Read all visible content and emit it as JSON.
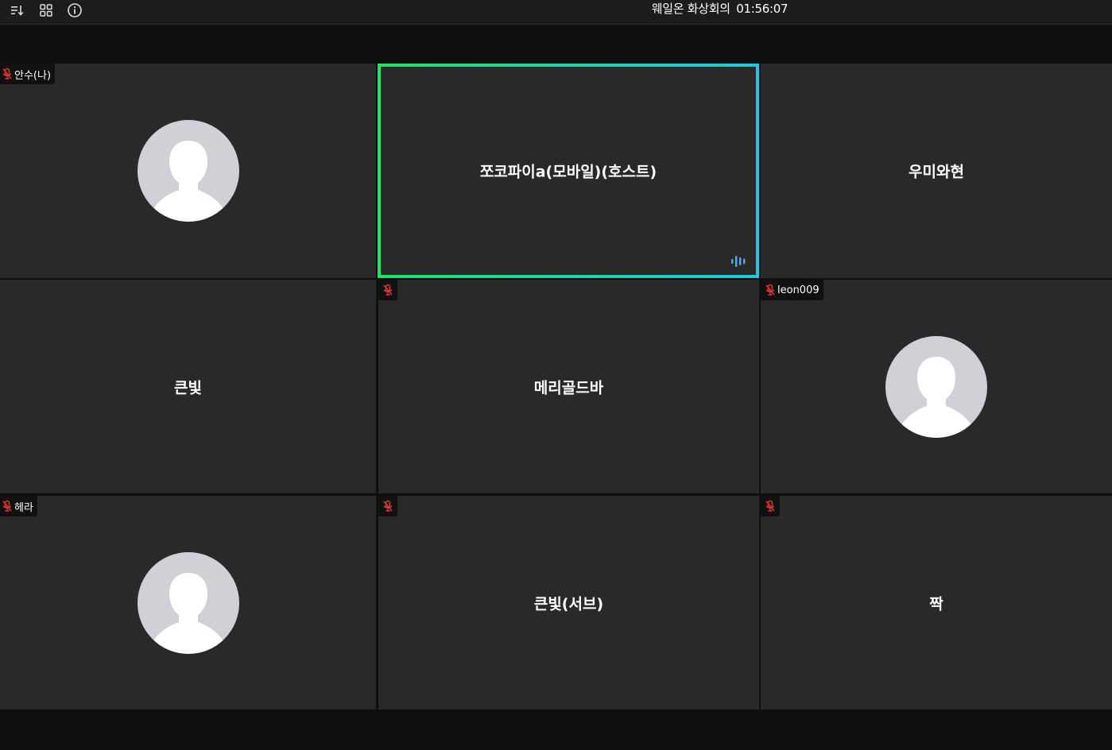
{
  "toolbar": {
    "icons": [
      "sort-list-icon",
      "grid-view-icon",
      "info-icon"
    ],
    "title": "웨일온 화상회의",
    "timer": "01:56:07"
  },
  "participants": [
    {
      "name": "안수(나)",
      "display": "avatar",
      "muted": true,
      "badge_label": "안수(나)"
    },
    {
      "name": "쪼코파이a(모바일)(호스트)",
      "display": "name",
      "muted": false,
      "speaking": true
    },
    {
      "name": "우미와현",
      "display": "name",
      "muted": false
    },
    {
      "name": "큰빛",
      "display": "name",
      "muted": false
    },
    {
      "name": "메리골드바",
      "display": "name",
      "muted": true
    },
    {
      "name": "leon009",
      "display": "avatar",
      "muted": true,
      "badge_label": "leon009"
    },
    {
      "name": "헤라",
      "display": "avatar",
      "muted": true,
      "badge_label": "헤라"
    },
    {
      "name": "큰빛(서브)",
      "display": "name",
      "muted": true
    },
    {
      "name": "짝",
      "display": "name",
      "muted": true
    }
  ],
  "colors": {
    "tile_bg": "#292929",
    "page_bg": "#0f0f0f",
    "active_border_start": "#1fe36b",
    "active_border_end": "#20c8e0",
    "muted_mic": "#e53935",
    "speaking_indicator": "#5aa9f0"
  }
}
